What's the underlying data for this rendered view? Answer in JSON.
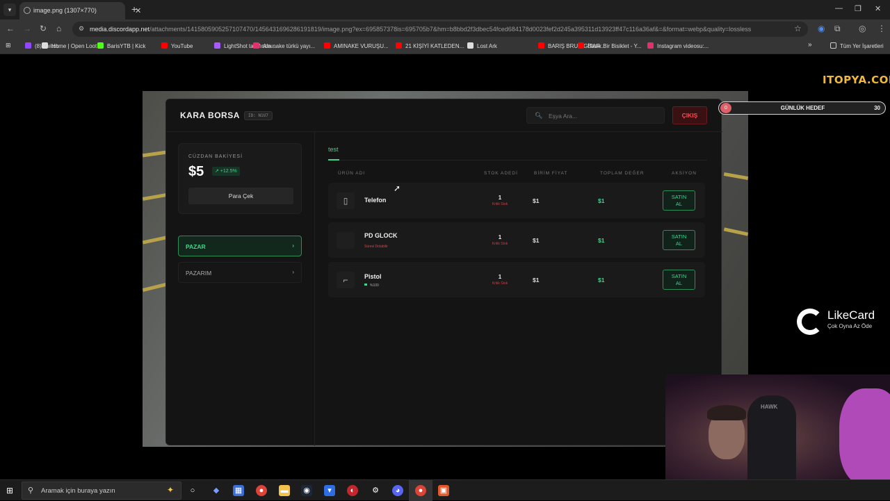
{
  "browser": {
    "tab_title": "image.png (1307×770)",
    "url_host": "media.discordapp.net",
    "url_rest": "/attachments/1415805905257107470/1456431696286191819/image.png?ex=695857378is=695705b7&hm=b8bbd2f3dbec54fced684178d0023fef2d245a395311d13923ff47c116a36af&=&format=webp&quality=lossless",
    "bookmarks": [
      {
        "label": "(8) Twitch",
        "color": "#9146ff"
      },
      {
        "label": "Home | Open Loot",
        "color": "#dddddd"
      },
      {
        "label": "BarisYTB | Kick",
        "color": "#53fc18"
      },
      {
        "label": "YouTube",
        "color": "#ff0000"
      },
      {
        "label": "LightShot tarafında...",
        "color": "#a75bff"
      },
      {
        "label": "Amınake türkü yayı...",
        "color": "#e1306c"
      },
      {
        "label": "AMINAKE VURUŞU...",
        "color": "#ff0000"
      },
      {
        "label": "21 KİŞİYİ KATLEDEN...",
        "color": "#ff0000"
      },
      {
        "label": "Lost Ark",
        "color": "#dddddd"
      },
      {
        "label": "BARIŞ BRUH GİTAR...",
        "color": "#ff0000"
      },
      {
        "label": "Basık Bir Bisiklet - Y...",
        "color": "#ff0000"
      },
      {
        "label": "Instagram videosu:...",
        "color": "#e1306c"
      }
    ],
    "all_bookmarks_label": "Tüm Yer İşaretleri"
  },
  "market": {
    "title": "KARA BORSA",
    "id_badge": "ID: N1U7",
    "search_placeholder": "Eşya Ara...",
    "exit_label": "ÇIKIŞ",
    "wallet": {
      "label": "CÜZDAN BAKİYESİ",
      "amount": "$5",
      "change": "↗ +12.5%",
      "withdraw_label": "Para Çek"
    },
    "nav": [
      {
        "label": "PAZAR",
        "active": true
      },
      {
        "label": "PAZARIM",
        "active": false
      }
    ],
    "category_tab": "test",
    "columns": [
      "ÜRÜN ADI",
      "STOK ADEDİ",
      "BİRİM FİYAT",
      "TOPLAM DEĞER",
      "AKSİYON"
    ],
    "products": [
      {
        "name": "Telefon",
        "sub": "",
        "stock": "1",
        "stock_label": "Kritik Stok",
        "price": "$1",
        "total": "$1",
        "action": "SATIN AL",
        "icon": "phone-icon"
      },
      {
        "name": "PD GLOCK",
        "sub": "Süresi Dolabilir",
        "stock": "1",
        "stock_label": "Kritik Stok",
        "price": "$1",
        "total": "$1",
        "action": "SATIN AL",
        "icon": "glock-icon"
      },
      {
        "name": "Pistol",
        "sub": "%100",
        "stock": "1",
        "stock_label": "Kritik Stok",
        "price": "$1",
        "total": "$1",
        "action": "SATIN AL",
        "icon": "pistol-icon"
      }
    ]
  },
  "overlays": {
    "goal_value": "0",
    "goal_label": "GÜNLÜK HEDEF",
    "goal_target": "30",
    "itopya": "ITOPYA.COM",
    "likecard_name": "LikeCard",
    "likecard_tag": "Çok Oyna  Az Öde",
    "webcam_brand": "HAWK"
  },
  "taskbar": {
    "search_placeholder": "Aramak için buraya yazın"
  },
  "colors": {
    "accent_green": "#3dd68c",
    "danger_red": "#ef4f55"
  }
}
